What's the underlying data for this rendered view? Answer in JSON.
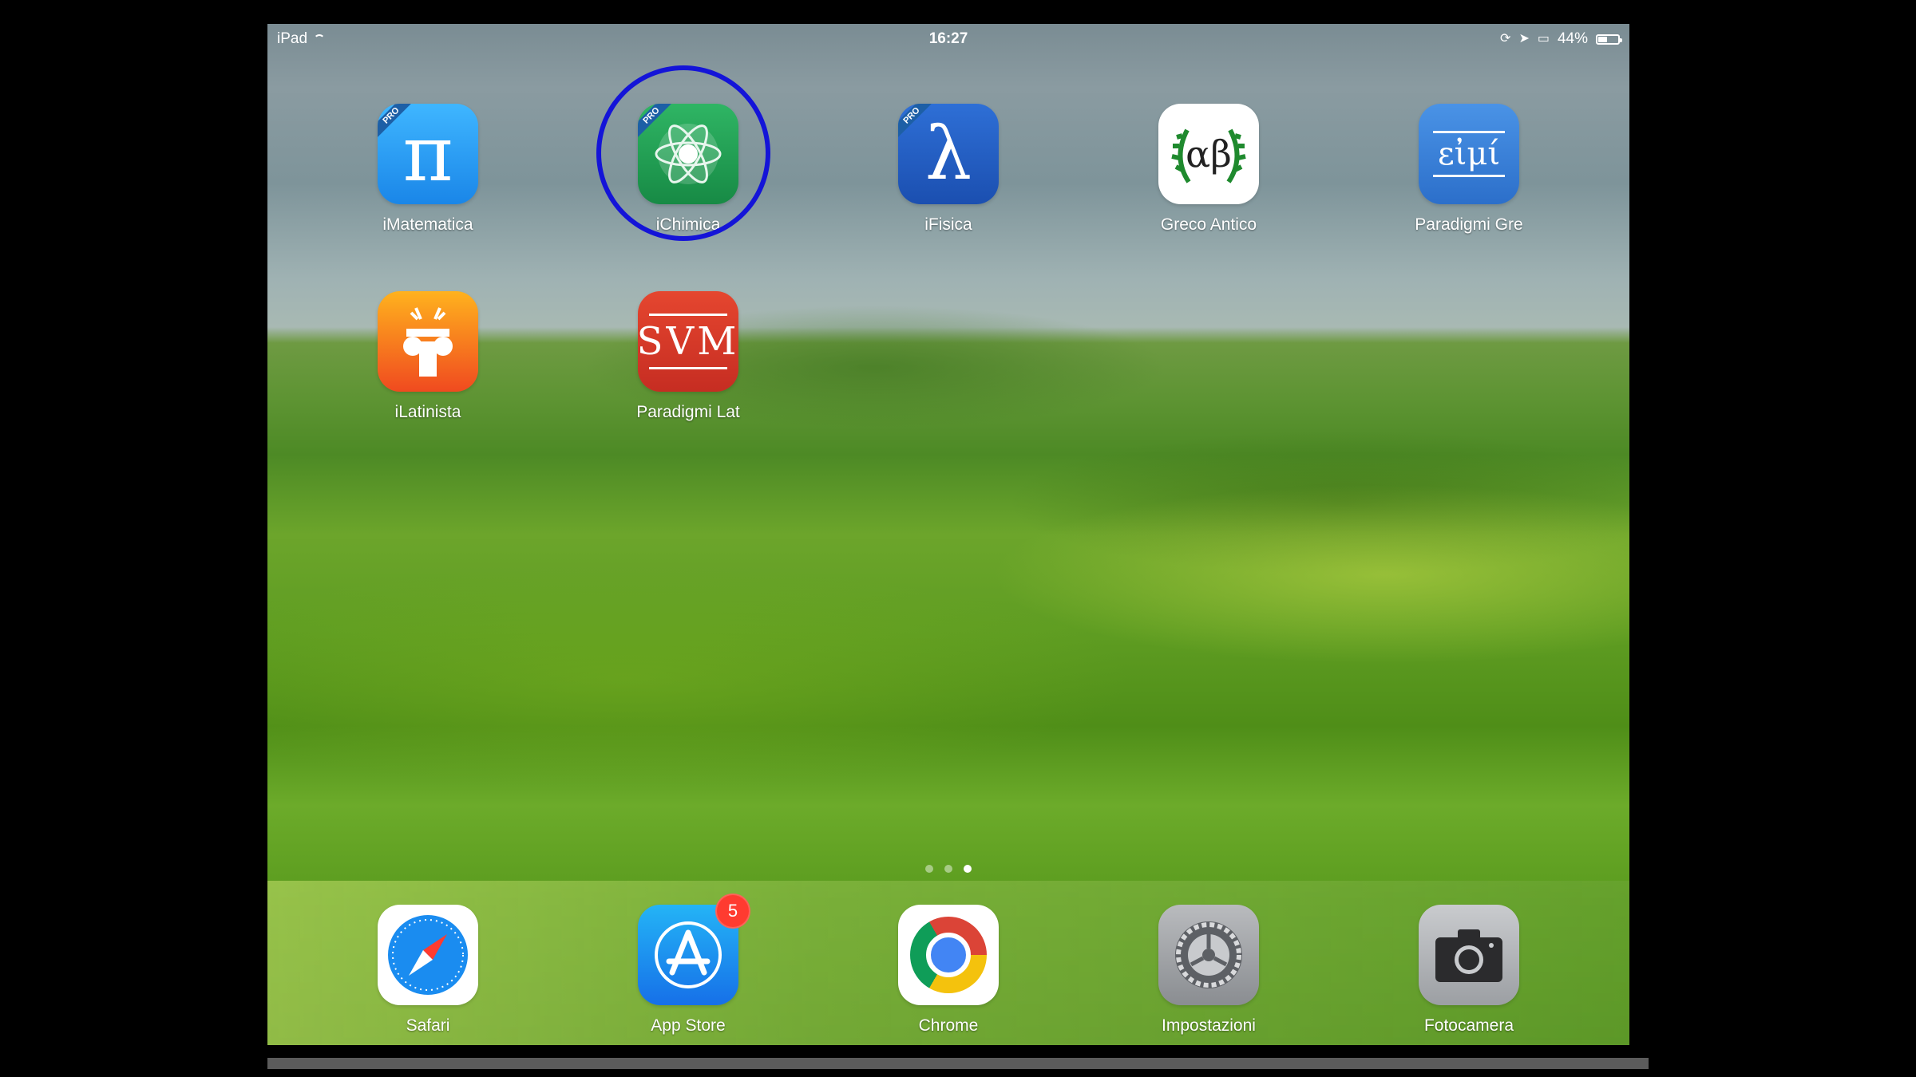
{
  "status_bar": {
    "device": "iPad",
    "time": "16:27",
    "battery_percent": "44%",
    "battery_level": 0.44
  },
  "apps": [
    {
      "label": "iMatematica",
      "glyph": "π",
      "pro": "PRO",
      "color": "#1f9cf0",
      "icon": "pi-icon"
    },
    {
      "label": "iChimica",
      "glyph": "",
      "pro": "PRO",
      "color": "#1e9950",
      "icon": "atom-icon"
    },
    {
      "label": "iFisica",
      "glyph": "λ",
      "pro": "PRO",
      "color": "#1f5cc4",
      "icon": "lambda-icon"
    },
    {
      "label": "Greco Antico",
      "glyph": "αβ",
      "pro": "",
      "color": "#ffffff",
      "icon": "laurel-icon"
    },
    {
      "label": "Paradigmi Gre",
      "glyph": "εἰμί",
      "pro": "",
      "color": "#3b82d8",
      "icon": "greek-word-icon"
    },
    {
      "label": "iLatinista",
      "glyph": "",
      "pro": "",
      "color": "#f59a1e",
      "icon": "column-icon"
    },
    {
      "label": "Paradigmi Lat",
      "glyph": "SVM",
      "pro": "",
      "color": "#d93a2b",
      "icon": "svm-icon"
    }
  ],
  "page_dots": {
    "count": 3,
    "active": 3
  },
  "dock": [
    {
      "label": "Safari",
      "icon": "compass-icon"
    },
    {
      "label": "App Store",
      "icon": "app-store-icon",
      "badge": "5"
    },
    {
      "label": "Chrome",
      "icon": "chrome-icon"
    },
    {
      "label": "Impostazioni",
      "icon": "gear-icon"
    },
    {
      "label": "Fotocamera",
      "icon": "camera-icon"
    }
  ]
}
